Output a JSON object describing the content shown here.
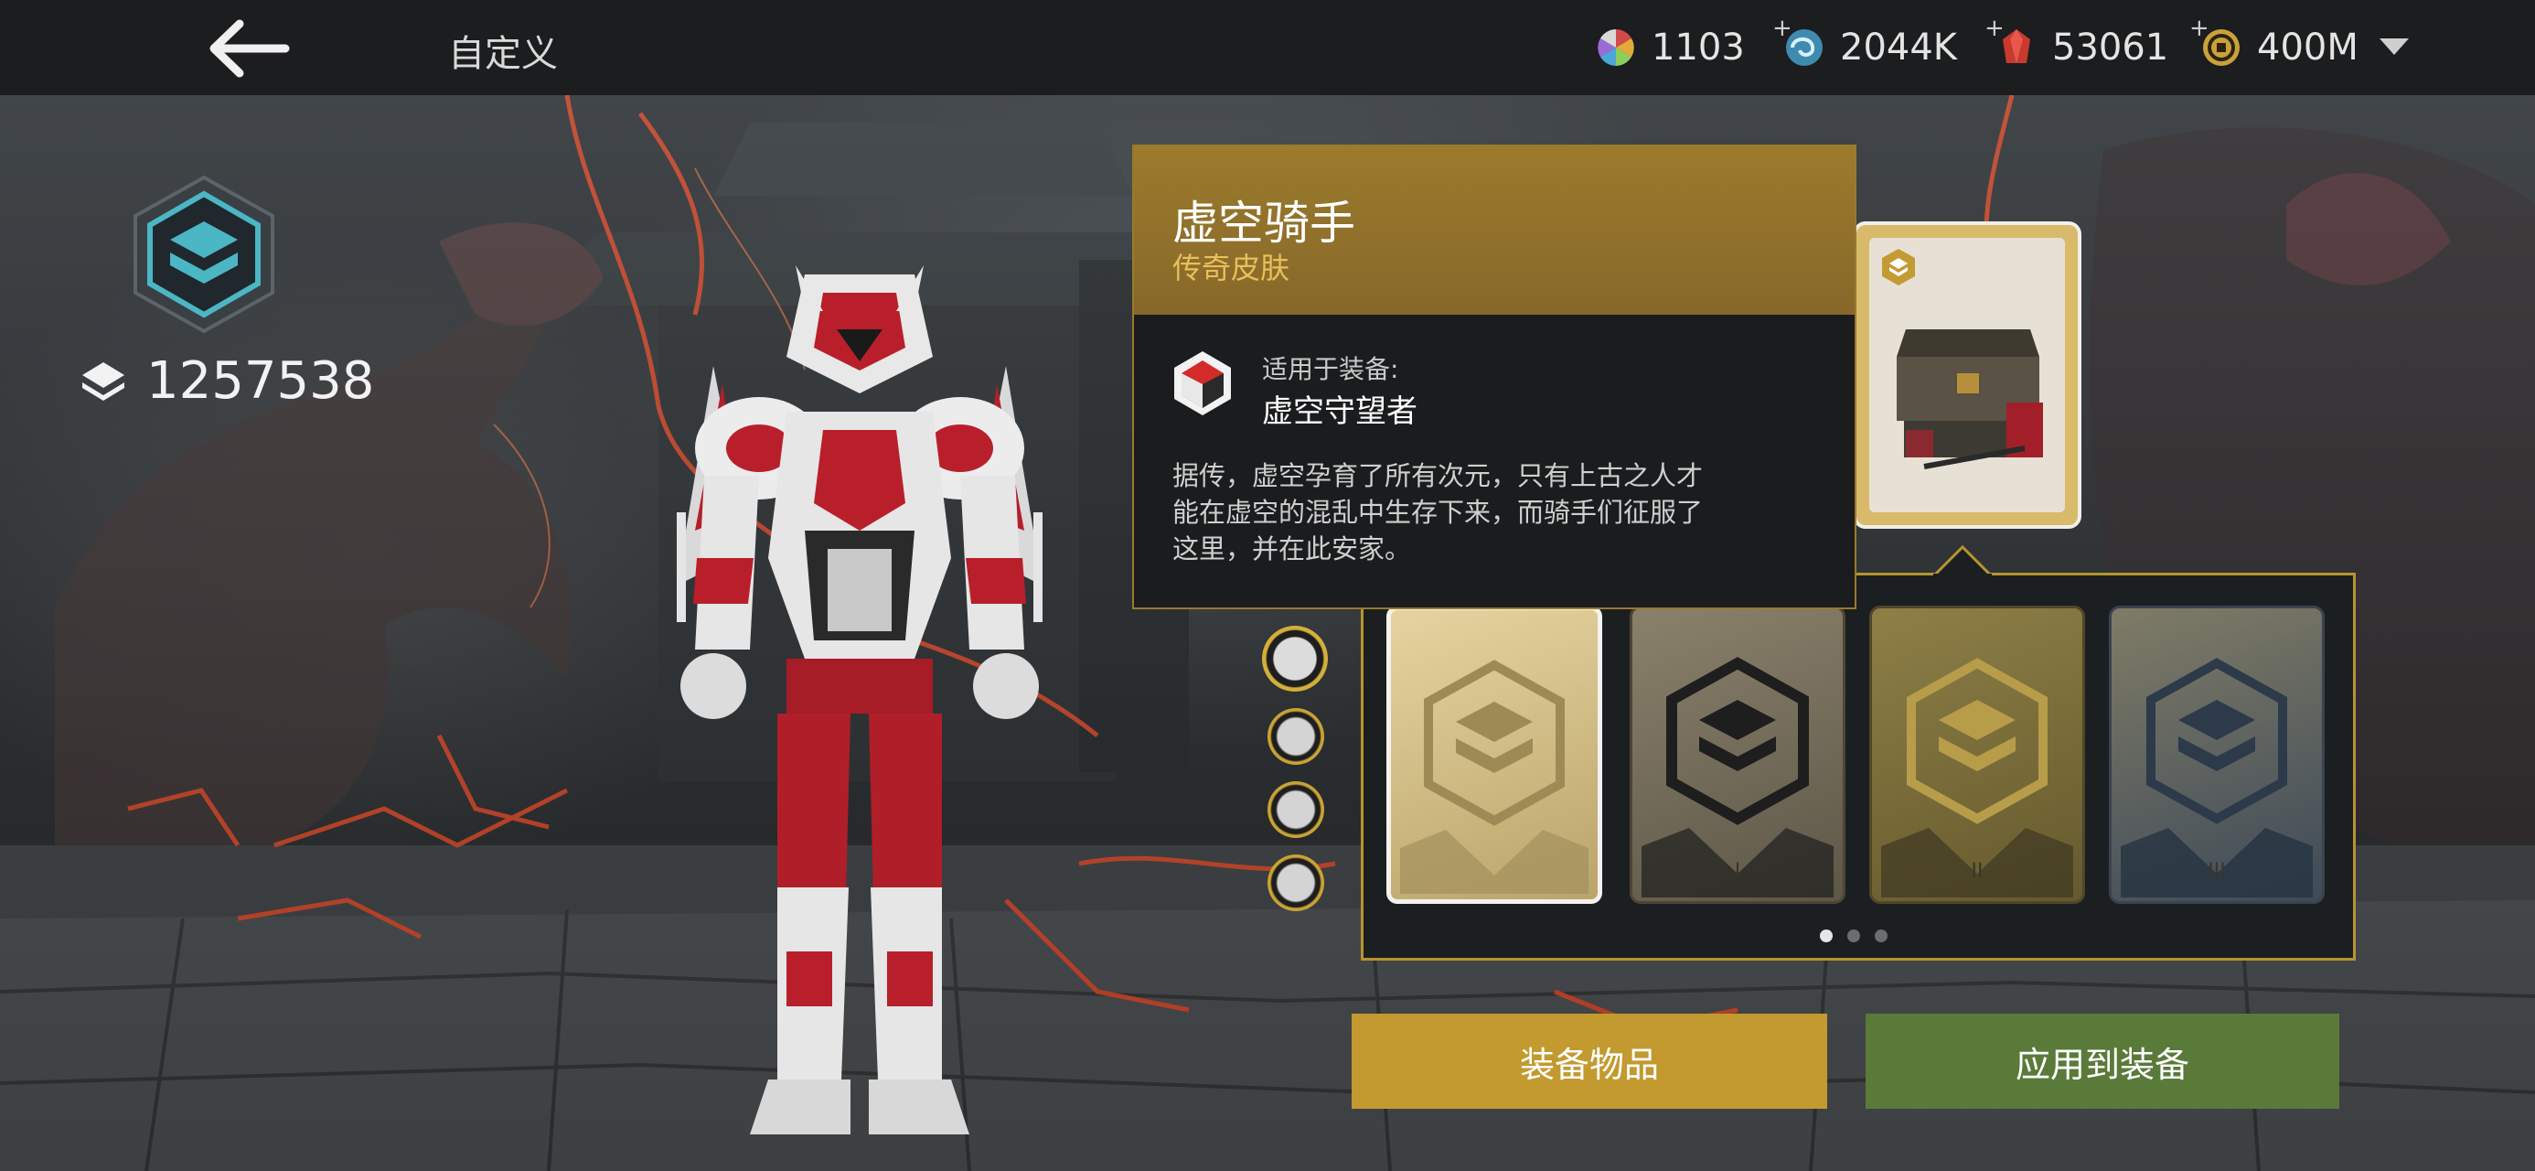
{
  "header": {
    "title": "自定义",
    "back_icon": "arrow-left-icon",
    "dropdown_icon": "caret-down-icon"
  },
  "currencies": [
    {
      "icon": "color-wheel-icon",
      "value": "1103",
      "has_plus": false
    },
    {
      "icon": "swirl-orb-icon",
      "value": "2044K",
      "has_plus": true
    },
    {
      "icon": "red-gem-icon",
      "value": "53061",
      "has_plus": true
    },
    {
      "icon": "gold-coin-icon",
      "value": "400M",
      "has_plus": true
    }
  ],
  "currency_plus": "+",
  "player": {
    "rank_icon": "rank-hexagon-icon",
    "score_icon": "diamond-stack-icon",
    "score": "1257538"
  },
  "tooltip": {
    "title": "虚空骑手",
    "subtitle": "传奇皮肤",
    "equip_label": "适用于装备:",
    "equip_name": "虚空守望者",
    "equip_icon": "armor-cube-icon",
    "description": "据传，虚空孕育了所有次元，只有上古之人才能在虚空的混乱中生存下来，而骑手们征服了这里，并在此安家。"
  },
  "skin_cards": [
    {
      "numeral": "",
      "selected": true
    },
    {
      "numeral": "I",
      "selected": false
    },
    {
      "numeral": "II",
      "selected": false
    },
    {
      "numeral": "III",
      "selected": false
    }
  ],
  "page_dots": {
    "count": 3,
    "active": 0
  },
  "buttons": {
    "equip": "装备物品",
    "apply": "应用到装备"
  },
  "colors": {
    "gold": "#c29a2f",
    "green": "#5a7a3a",
    "tooltip_header": "#9c7b2c",
    "rarity_text": "#e7c05c",
    "panel_border": "#b6952f"
  }
}
